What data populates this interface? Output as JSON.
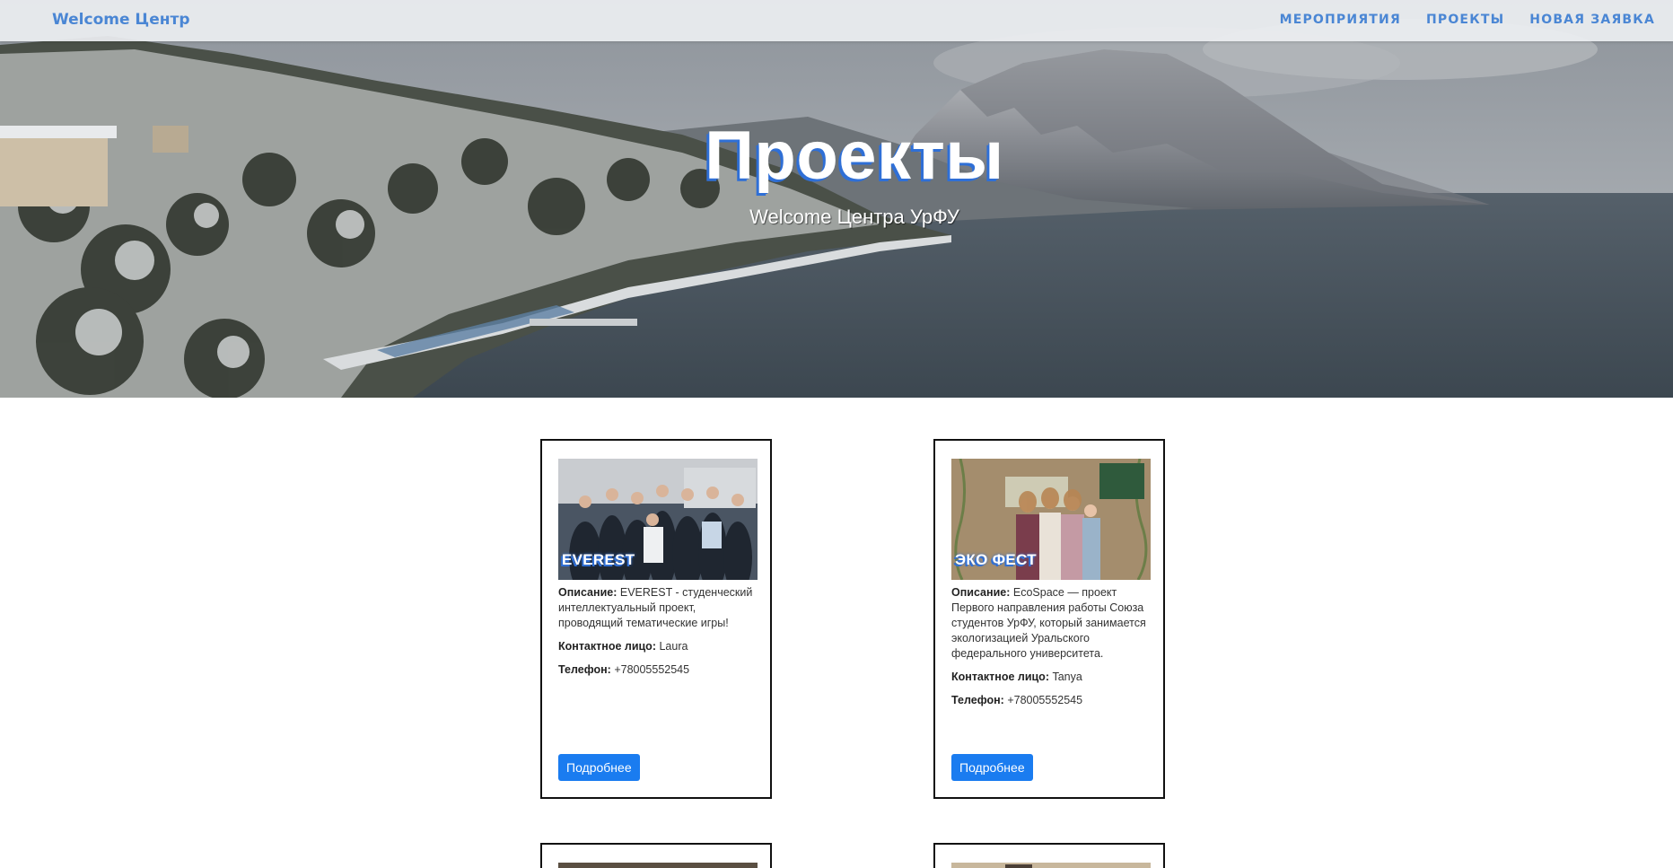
{
  "navbar": {
    "brand": "Welcome Центр",
    "links": [
      {
        "label": "Мероприятия"
      },
      {
        "label": "Проекты"
      },
      {
        "label": "Новая заявка"
      }
    ]
  },
  "hero": {
    "title": "Проекты",
    "subtitle": "Welcome Центра УрФУ"
  },
  "labels": {
    "description": "Описание:",
    "contact": "Контактное лицо:",
    "phone": "Телефон:"
  },
  "projects": [
    {
      "title": "EVEREST",
      "description": "EVEREST - студенческий интеллектуальный проект, проводящий тематические игры!",
      "contact": "Laura",
      "phone": "+78005552545",
      "button": "Подробнее"
    },
    {
      "title": "ЭКО ФЕСТ",
      "description": "EcoSpace — проект Первого направления работы Союза студентов УрФУ, который занимается экологизацией Уральского федерального университета.",
      "contact": "Tanya",
      "phone": "+78005552545",
      "button": "Подробнее"
    }
  ],
  "colors": {
    "accent": "#4a86d4",
    "button": "#1a7cf0",
    "title_shadow": "#2f6fd6"
  }
}
